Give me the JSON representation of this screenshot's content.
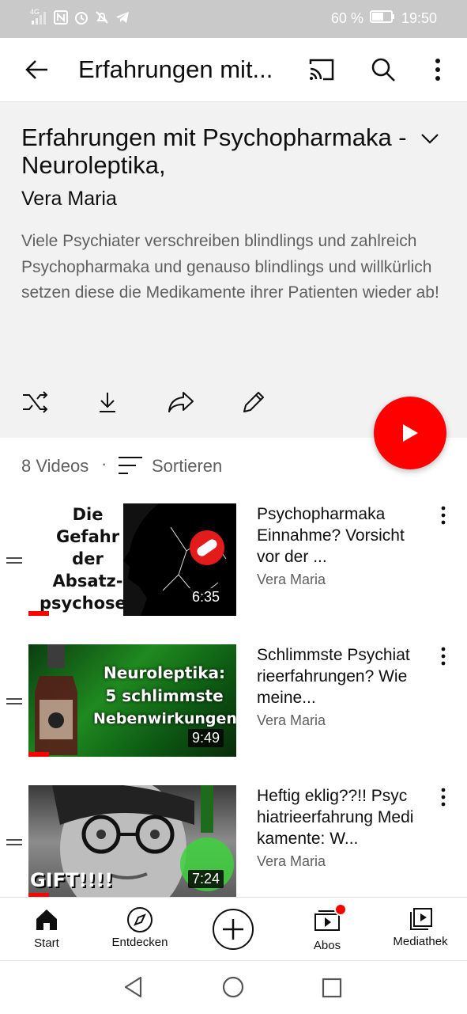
{
  "status_bar": {
    "network": "4G",
    "battery": "60 %",
    "time": "19:50"
  },
  "app_bar": {
    "title": "Erfahrungen mit...",
    "icons": [
      "back-arrow-icon",
      "cast-icon",
      "search-icon",
      "more-vert-icon"
    ]
  },
  "playlist": {
    "title": "Erfahrungen mit Psychopharmaka - Neuroleptika,",
    "owner": "Vera Maria",
    "description": "Viele Psychiater verschreiben blindlings und zahlreich Psychopharmaka und genauso blindlings und willkürlich setzen diese die Medikamente ihrer Patienten wieder ab!",
    "actions": [
      "shuffle-icon",
      "download-icon",
      "share-icon",
      "edit-icon"
    ]
  },
  "list_header": {
    "count": "8 Videos",
    "separator": "·",
    "sort_label": "Sortieren"
  },
  "videos": [
    {
      "title": "Psychopharmaka Einnahme? Vorsicht vor der ...",
      "channel": "Vera Maria",
      "duration": "6:35",
      "watched_fraction": 0.1,
      "thumb_text": [
        "Die",
        "Gefahr",
        "der",
        "Absatz-",
        "psychose?"
      ]
    },
    {
      "title": "Schlimmste Psychiatrieerfahrungen? Wie meine...",
      "channel": "Vera Maria",
      "duration": "9:49",
      "watched_fraction": 0.1,
      "thumb_text": [
        "Neuroleptika:",
        "5 schlimmste",
        "Nebenwirkungen"
      ]
    },
    {
      "title": "Heftig eklig??!! Psychiatrieerfahrung Medikamente: W...",
      "channel": "Vera Maria",
      "duration": "7:24",
      "watched_fraction": 0.1,
      "thumb_text": [
        "GIFT!!!!"
      ]
    }
  ],
  "bottom_nav": [
    {
      "label": "Start",
      "icon": "home-icon",
      "active": true
    },
    {
      "label": "Entdecken",
      "icon": "explore-icon"
    },
    {
      "label": "",
      "icon": "create-plus-icon"
    },
    {
      "label": "Abos",
      "icon": "subscriptions-icon",
      "badge": true
    },
    {
      "label": "Mediathek",
      "icon": "library-icon"
    }
  ],
  "colors": {
    "accent": "#ff0000",
    "header_bg": "#f2f2f2",
    "status_bar_bg": "#c9c9c9",
    "secondary_text": "#606060"
  }
}
